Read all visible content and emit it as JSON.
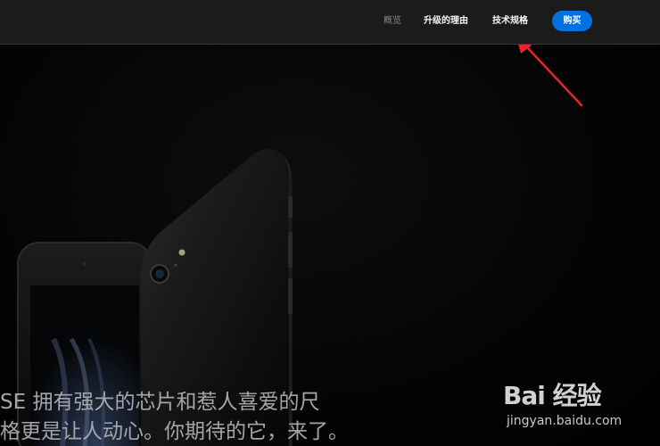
{
  "nav": {
    "overview": "概览",
    "why_upgrade": "升级的理由",
    "tech_specs": "技术规格",
    "buy": "购买"
  },
  "hero": {
    "headline_line1": "SE 拥有强大的芯片和惹人喜爱的尺",
    "headline_line2": "格更是让人动心。你期待的它，来了。"
  },
  "watermark": {
    "logo_text": "Bai 经验",
    "url": "jingyan.baidu.com"
  },
  "colors": {
    "nav_bg": "#1b1b1c",
    "buy_button": "#0071e3",
    "annotation_arrow": "#e8262a"
  }
}
